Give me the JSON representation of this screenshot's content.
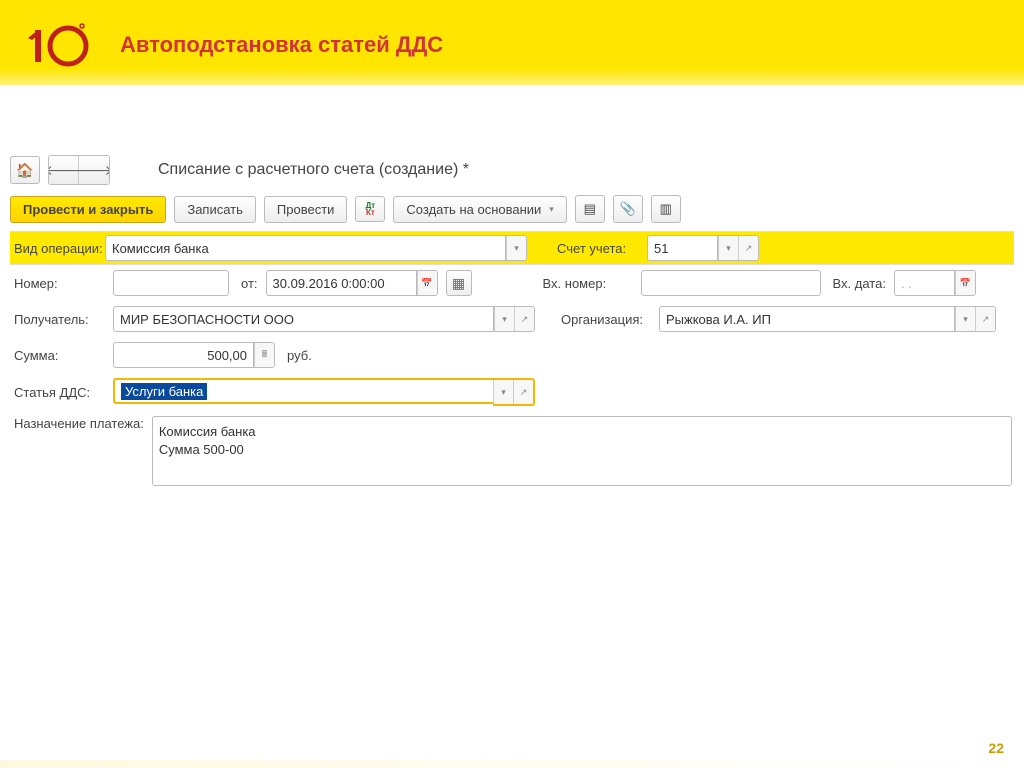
{
  "slide": {
    "title": "Автоподстановка статей ДДС",
    "page_number": "22"
  },
  "navbar": {
    "home_icon": "🏠",
    "back_icon": "🡐",
    "forward_icon": "🡒"
  },
  "form": {
    "title": "Списание с расчетного счета (создание) *"
  },
  "toolbar": {
    "post_and_close": "Провести и закрыть",
    "save": "Записать",
    "post": "Провести",
    "create_based": "Создать на основании"
  },
  "fields": {
    "operation_type_label": "Вид операции:",
    "operation_type_value": "Комиссия банка",
    "account_label": "Счет учета:",
    "account_value": "51",
    "number_label": "Номер:",
    "number_value": "",
    "date_label": "от:",
    "date_value": "30.09.2016  0:00:00",
    "in_number_label": "Вх. номер:",
    "in_number_value": "",
    "in_date_label": "Вх. дата:",
    "in_date_value": ". .",
    "recipient_label": "Получатель:",
    "recipient_value": "МИР БЕЗОПАСНОСТИ ООО",
    "organization_label": "Организация:",
    "organization_value": "Рыжкова И.А. ИП",
    "amount_label": "Сумма:",
    "amount_value": "500,00",
    "amount_suffix": "руб.",
    "dds_label": "Статья ДДС:",
    "dds_value": "Услуги банка",
    "purpose_label": "Назначение платежа:",
    "purpose_value": "Комиссия банка\nСумма 500-00"
  }
}
